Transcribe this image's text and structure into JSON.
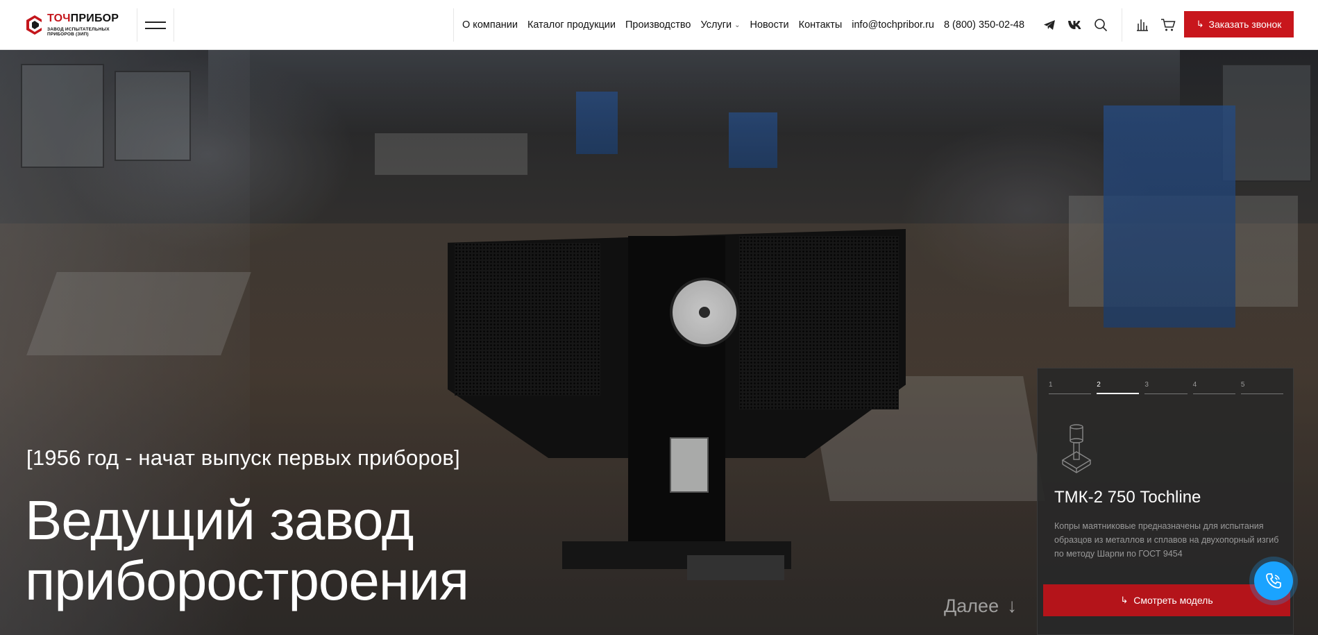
{
  "brand": {
    "name_red": "ТОЧ",
    "name_dark": "ПРИБОР",
    "subtitle_line1": "ЗАВОД ИСПЫТАТЕЛЬНЫХ",
    "subtitle_line2": "ПРИБОРОВ (ЗИП)"
  },
  "nav": {
    "items": [
      {
        "label": "О компании"
      },
      {
        "label": "Каталог продукции"
      },
      {
        "label": "Производство"
      },
      {
        "label": "Услуги"
      },
      {
        "label": "Новости"
      },
      {
        "label": "Контакты"
      }
    ],
    "email": "info@tochpribor.ru",
    "phone": "8 (800) 350-02-48"
  },
  "header_icons": [
    "telegram-icon",
    "vk-icon",
    "search-icon",
    "compare-icon",
    "cart-icon"
  ],
  "call_button": {
    "label": "Заказать звонок"
  },
  "hero": {
    "subtitle": "[1956 год - начат выпуск первых приборов]",
    "title_line1": "Ведущий завод",
    "title_line2": "приборостроения",
    "more_label": "Далее"
  },
  "product_card": {
    "steps": [
      "1",
      "2",
      "3",
      "4",
      "5"
    ],
    "active_step": "2",
    "title": "ТМК-2 750 Tochline",
    "description": "Копры маятниковые предназначены для испытания образцов из металлов и сплавов на двухопорный изгиб по методу Шарпи по ГОСТ 9454",
    "button_label": "Смотреть модель"
  },
  "colors": {
    "accent_red": "#c8161c",
    "fab_blue": "#1aa3ff"
  }
}
